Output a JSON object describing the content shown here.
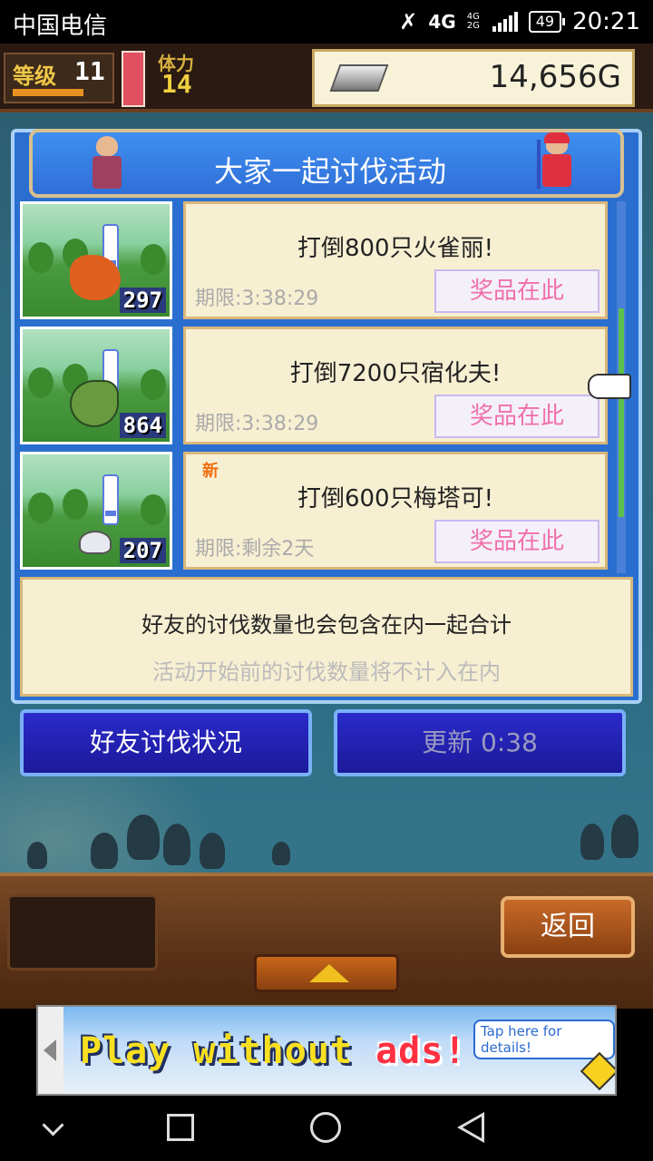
{
  "status_bar": {
    "carrier": "中国电信",
    "network": "4G",
    "network_small": "4G 2G",
    "battery": "49",
    "time": "20:21"
  },
  "hud": {
    "level_label": "等级",
    "level_value": "11",
    "stamina_label": "体力",
    "stamina_value": "14",
    "gold": "14,656G"
  },
  "dialog": {
    "title": "大家一起讨伐活动",
    "missions": [
      {
        "title": "打倒800只火雀丽!",
        "deadline": "期限:3:38:29",
        "button": "奖品在此",
        "count": "297",
        "badge": "",
        "monster_color": "#e06020"
      },
      {
        "title": "打倒7200只宿化夫!",
        "deadline": "期限:3:38:29",
        "button": "奖品在此",
        "count": "864",
        "badge": "",
        "monster_color": "#6a9a40"
      },
      {
        "title": "打倒600只梅塔可!",
        "deadline": "期限:剩余2天",
        "button": "奖品在此",
        "count": "207",
        "badge": "新",
        "monster_color": "#e8e8f0"
      }
    ],
    "note_line1": "好友的讨伐数量也会包含在内一起合计",
    "note_line2": "活动开始前的讨伐数量将不计入在内"
  },
  "buttons": {
    "friends": "好友讨伐状况",
    "refresh": "更新 0:38",
    "back": "返回"
  },
  "ad": {
    "word1": "Play",
    "word2": "without",
    "word3": "ads!",
    "tag": "Tap here for details!"
  },
  "colors": {
    "dialog_blue": "#2a6fd0",
    "card_bg": "#f7efd2",
    "prize_text": "#f070a8",
    "button_blue": "#1c1a9a"
  }
}
